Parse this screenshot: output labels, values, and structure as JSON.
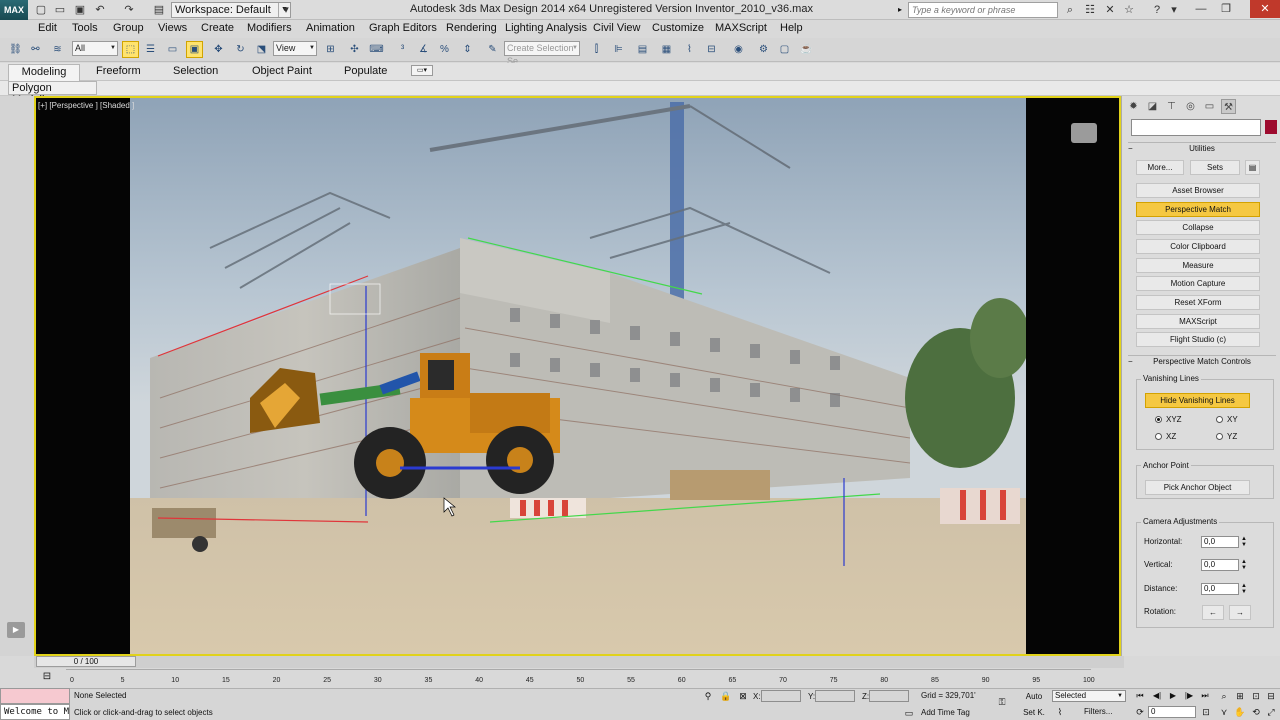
{
  "title_bar": {
    "logo": "MAX",
    "workspace": "Workspace: Default",
    "title": "Autodesk 3ds Max Design 2014 x64    Unregistered Version    Inventor_2010_v36.max",
    "search_placeholder": "Type a keyword or phrase"
  },
  "menu": [
    "Edit",
    "Tools",
    "Group",
    "Views",
    "Create",
    "Modifiers",
    "Animation",
    "Graph Editors",
    "Rendering",
    "Lighting Analysis",
    "Civil View",
    "Customize",
    "MAXScript",
    "Help"
  ],
  "toolbar": {
    "selection_filter": "All",
    "ref_coord": "View",
    "named_selection_placeholder": "Create Selection Se"
  },
  "ribbon": {
    "tabs": [
      "Modeling",
      "Freeform",
      "Selection",
      "Object Paint",
      "Populate"
    ],
    "active_tab": "Modeling",
    "panel_label": "Polygon Modeling"
  },
  "viewport": {
    "label": "[+] [Perspective ] [Shaded ]"
  },
  "command_panel": {
    "utilities_header": "Utilities",
    "more_button": "More...",
    "sets_button": "Sets",
    "utility_buttons": [
      "Asset Browser",
      "Perspective Match",
      "Collapse",
      "Color Clipboard",
      "Measure",
      "Motion Capture",
      "Reset XForm",
      "MAXScript",
      "Flight Studio (c)"
    ],
    "highlighted_utility": "Perspective Match",
    "pm_header": "Perspective Match Controls",
    "vanishing_lines_group": "Vanishing Lines",
    "hide_vanishing_lines": "Hide Vanishing Lines",
    "radios": [
      {
        "label": "XYZ",
        "checked": true
      },
      {
        "label": "XY",
        "checked": false
      },
      {
        "label": "XZ",
        "checked": false
      },
      {
        "label": "YZ",
        "checked": false
      }
    ],
    "anchor_group": "Anchor Point",
    "pick_anchor": "Pick Anchor Object",
    "camera_group": "Camera Adjustments",
    "horizontal_label": "Horizontal:",
    "horizontal_value": "0,0",
    "vertical_label": "Vertical:",
    "vertical_value": "0,0",
    "distance_label": "Distance:",
    "distance_value": "0,0",
    "rotation_label": "Rotation:",
    "rotate_left": "←",
    "rotate_right": "→"
  },
  "timeline": {
    "slider": "0 / 100",
    "ticks": [
      "0",
      "5",
      "10",
      "15",
      "20",
      "25",
      "30",
      "35",
      "40",
      "45",
      "50",
      "55",
      "60",
      "65",
      "70",
      "75",
      "80",
      "85",
      "90",
      "95",
      "100"
    ]
  },
  "status": {
    "maxscript_listener": "Welcome to MAXScript.",
    "selection": "None Selected",
    "prompt": "Click or click-and-drag to select objects",
    "x_label": "X:",
    "y_label": "Y:",
    "z_label": "Z:",
    "grid": "Grid = 329,701'",
    "add_time_tag": "Add Time Tag",
    "auto": "Auto",
    "set_key": "Set K.",
    "key_filter": "Selected",
    "filters": "Filters...",
    "frame": "0"
  },
  "colors": {
    "viewport_border": "#e1d21a",
    "highlight": "#f5c842",
    "object_color": "#9d0a2e",
    "vanishing_red": "#e0353a",
    "vanishing_green": "#43d84a",
    "vanishing_blue": "#2a3ad0"
  }
}
